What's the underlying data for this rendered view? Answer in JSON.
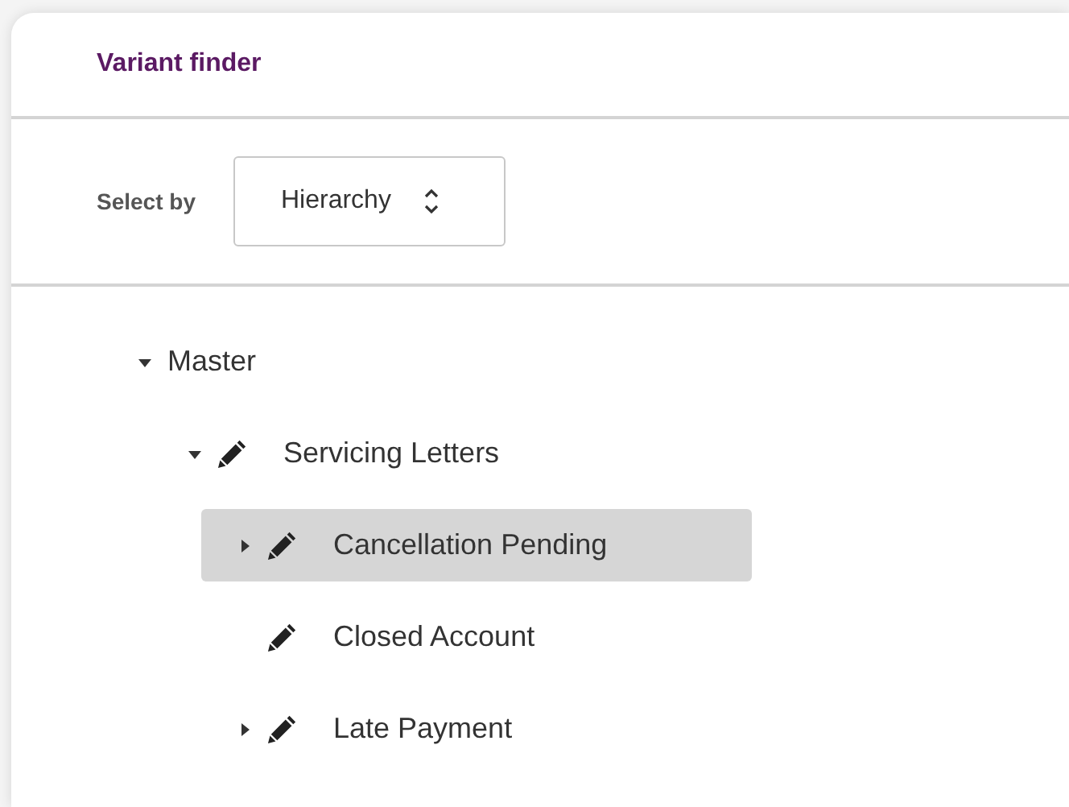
{
  "panel": {
    "title": "Variant finder"
  },
  "select_by": {
    "label": "Select by",
    "value": "Hierarchy"
  },
  "tree": [
    {
      "label": "Master",
      "editable": false,
      "expanded": true,
      "selected": false,
      "children": [
        {
          "label": "Servicing Letters",
          "editable": true,
          "expanded": true,
          "selected": false,
          "children": [
            {
              "label": "Cancellation Pending",
              "editable": true,
              "expanded": false,
              "selected": true
            },
            {
              "label": "Closed Account",
              "editable": true,
              "selected": false
            },
            {
              "label": "Late Payment",
              "editable": true,
              "expanded": false,
              "selected": false
            }
          ]
        }
      ]
    }
  ]
}
